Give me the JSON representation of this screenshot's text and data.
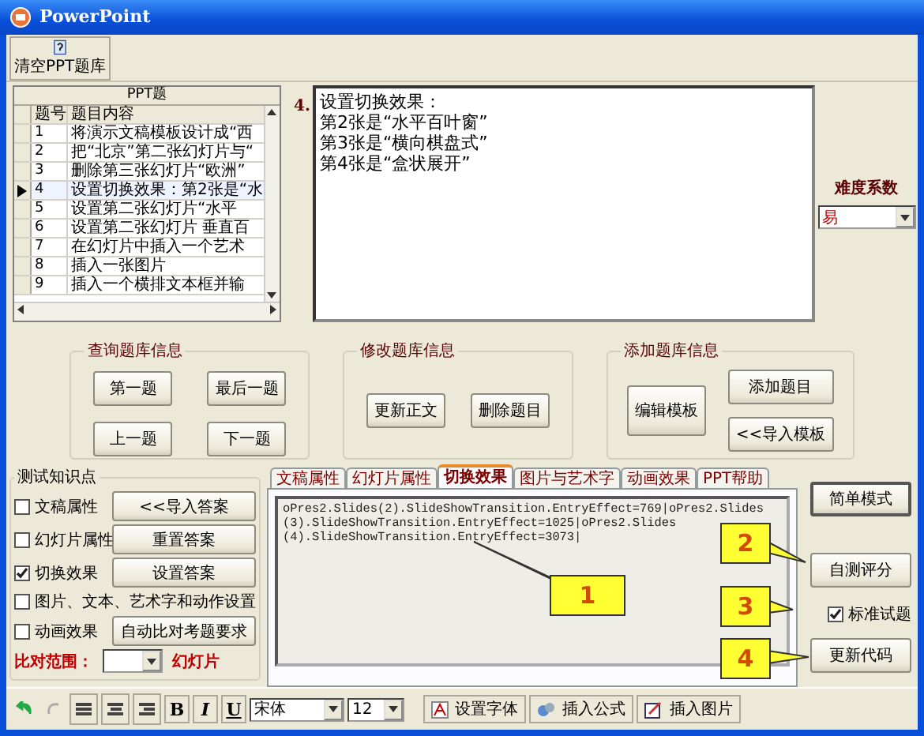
{
  "window": {
    "title": "PowerPoint"
  },
  "toolbar": {
    "clear_button": "清空PPT题库"
  },
  "question_grid": {
    "title": "PPT题",
    "columns": [
      "题号",
      "题目内容"
    ],
    "rows": [
      {
        "number": "1",
        "content": "将演示文稿模板设计成“西",
        "selected": false
      },
      {
        "number": "2",
        "content": "把“北京”第二张幻灯片与“",
        "selected": false
      },
      {
        "number": "3",
        "content": "删除第三张幻灯片“欧洲”",
        "selected": false
      },
      {
        "number": "4",
        "content": "设置切换效果：第2张是“水",
        "selected": true
      },
      {
        "number": "5",
        "content": "设置第二张幻灯片“水平",
        "selected": false
      },
      {
        "number": "6",
        "content": "设置第二张幻灯片 垂直百",
        "selected": false
      },
      {
        "number": "7",
        "content": "在幻灯片中插入一个艺术",
        "selected": false
      },
      {
        "number": "8",
        "content": "插入一张图片",
        "selected": false
      },
      {
        "number": "9",
        "content": "插入一个横排文本框并输",
        "selected": false
      }
    ]
  },
  "question": {
    "number": "4.",
    "lines": [
      "设置切换效果：",
      "第2张是“水平百叶窗”",
      "第3张是“横向棋盘式”",
      "第4张是“盒状展开”"
    ]
  },
  "difficulty": {
    "label": "难度系数",
    "value": "易"
  },
  "groups": [
    {
      "title": "查询题库信息",
      "kind": "grid",
      "buttons": [
        "第一题",
        "最后一题",
        "上一题",
        "下一题"
      ]
    },
    {
      "title": "修改题库信息",
      "kind": "row",
      "buttons": [
        "更新正文",
        "删除题目"
      ]
    },
    {
      "title": "添加题库信息",
      "kind": "split",
      "buttons": [
        "编辑模板",
        "添加题目",
        "<<导入模板"
      ]
    }
  ],
  "knowledge_points": {
    "title": "测试知识点",
    "items": [
      {
        "label": "文稿属性",
        "checked": false
      },
      {
        "label": "幻灯片属性",
        "checked": false
      },
      {
        "label": "切换效果",
        "checked": true
      },
      {
        "label": "图片、文本、艺术字和动作设置",
        "checked": false
      },
      {
        "label": "动画效果",
        "checked": false
      }
    ],
    "buttons": [
      "<<导入答案",
      "重置答案",
      "设置答案",
      "自动比对考题要求"
    ],
    "range_label": "比对范围：",
    "range_unit": "幻灯片"
  },
  "tabs": [
    {
      "label": "文稿属性",
      "selected": false
    },
    {
      "label": "幻灯片属性",
      "selected": false
    },
    {
      "label": "切换效果",
      "selected": true
    },
    {
      "label": "图片与艺术字",
      "selected": false
    },
    {
      "label": "动画效果",
      "selected": false
    },
    {
      "label": "PPT帮助",
      "selected": false
    }
  ],
  "code_lines": [
    "oPres2.Slides(2).SlideShowTransition.EntryEffect=769|oPres2.Slides",
    "(3).SlideShowTransition.EntryEffect=1025|oPres2.Slides",
    "(4).SlideShowTransition.EntryEffect=3073|"
  ],
  "side": {
    "simple_mode": "简单模式",
    "self_test": "自测评分",
    "standard": {
      "label": "标准试题",
      "checked": true
    },
    "update_code": "更新代码"
  },
  "callouts": [
    "1",
    "2",
    "3",
    "4"
  ],
  "format_toolbar": {
    "bold": "B",
    "italic": "I",
    "underline": "U",
    "font": "宋体",
    "size": "12",
    "tools": [
      "设置字体",
      "插入公式",
      "插入图片"
    ]
  }
}
